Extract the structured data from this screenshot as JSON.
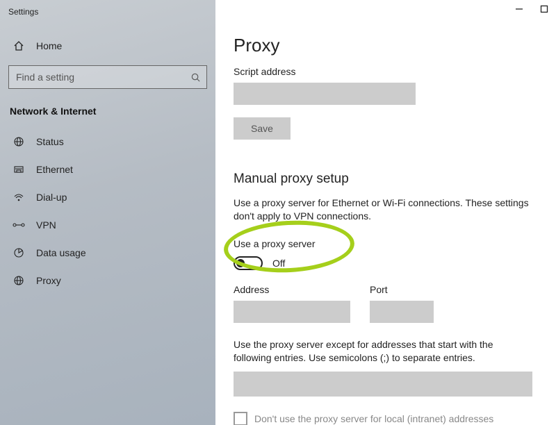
{
  "window": {
    "app_label": "Settings"
  },
  "sidebar": {
    "home_label": "Home",
    "search_placeholder": "Find a setting",
    "section_title": "Network & Internet",
    "items": [
      {
        "label": "Status",
        "icon": "globe-icon"
      },
      {
        "label": "Ethernet",
        "icon": "ethernet-icon"
      },
      {
        "label": "Dial-up",
        "icon": "dialup-icon"
      },
      {
        "label": "VPN",
        "icon": "vpn-icon"
      },
      {
        "label": "Data usage",
        "icon": "datausage-icon"
      },
      {
        "label": "Proxy",
        "icon": "proxy-icon"
      }
    ]
  },
  "main": {
    "title": "Proxy",
    "script_address_label": "Script address",
    "script_address_value": "",
    "save_label": "Save",
    "manual_heading": "Manual proxy setup",
    "manual_desc": "Use a proxy server for Ethernet or Wi-Fi connections. These settings don't apply to VPN connections.",
    "use_proxy_label": "Use a proxy server",
    "use_proxy_state": "Off",
    "address_label": "Address",
    "address_value": "",
    "port_label": "Port",
    "port_value": "",
    "exceptions_desc": "Use the proxy server except for addresses that start with the following entries. Use semicolons (;) to separate entries.",
    "exceptions_value": "",
    "bypass_local_label": "Don't use the proxy server for local (intranet) addresses"
  },
  "annotation": {
    "highlight_target": "use-proxy-toggle"
  }
}
